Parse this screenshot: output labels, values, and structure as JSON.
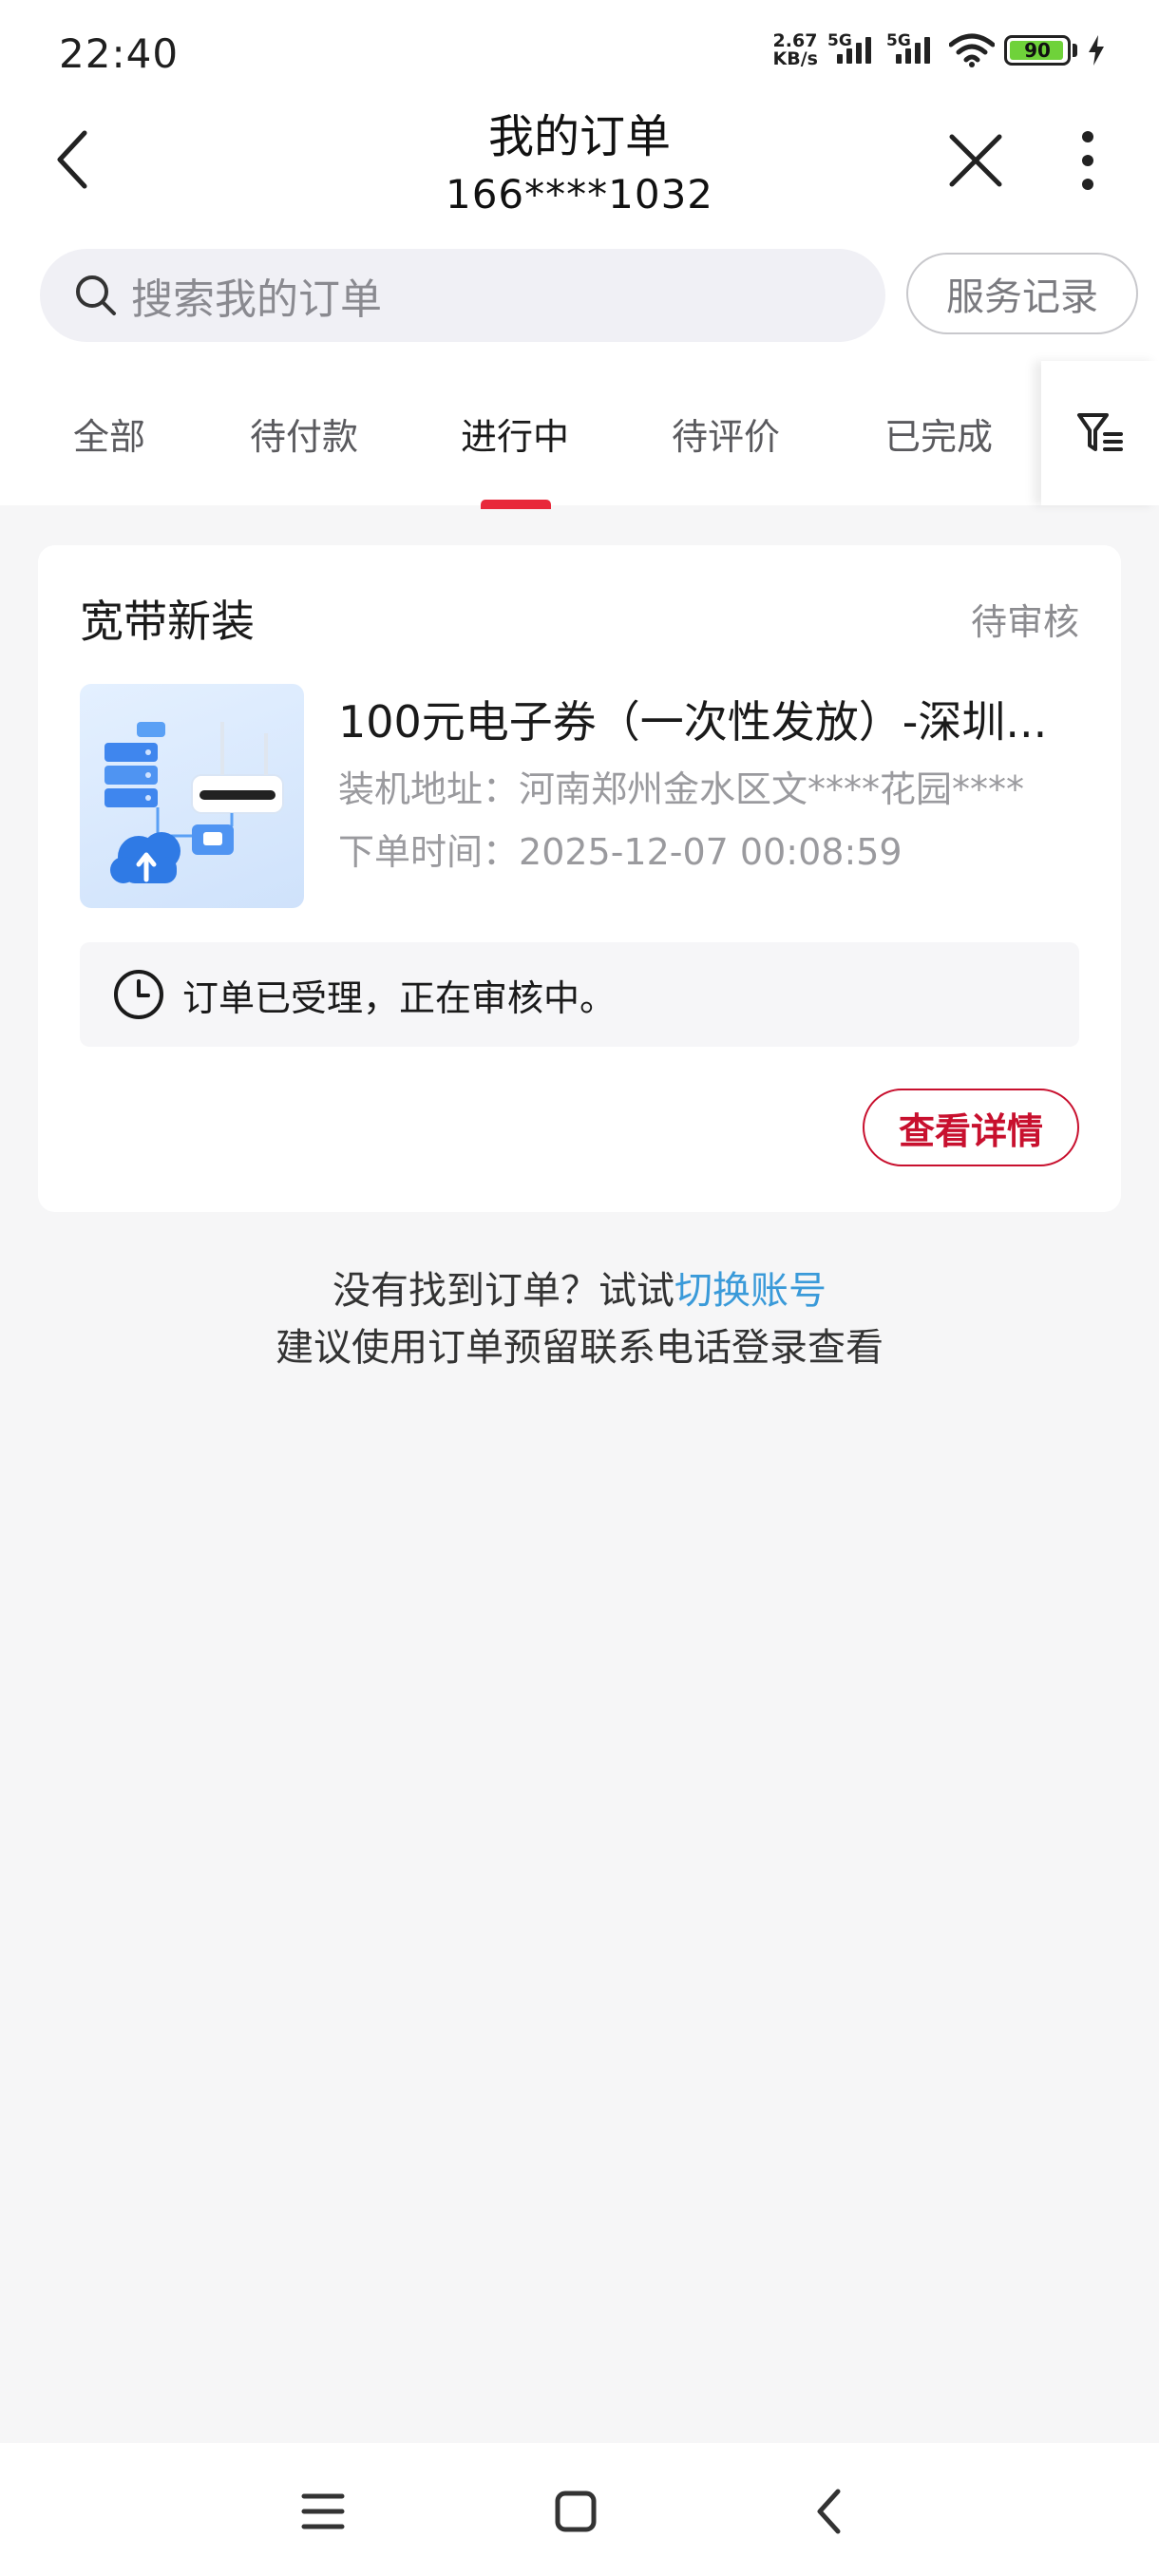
{
  "status_bar": {
    "time": "22:40",
    "net_speed_value": "2.67",
    "net_speed_unit": "KB/s",
    "sim1_type": "5G",
    "sim2_type": "5G",
    "battery_level": "90",
    "icons": [
      "signal-icon",
      "signal-icon",
      "wifi-icon",
      "battery-icon",
      "charging-icon"
    ]
  },
  "header": {
    "title": "我的订单",
    "subtitle": "166****1032",
    "icons": [
      "back-icon",
      "close-icon",
      "more-icon"
    ]
  },
  "search": {
    "placeholder": "搜索我的订单",
    "service_records_label": "服务记录"
  },
  "tabs": {
    "items": [
      {
        "label": "全部",
        "active": false
      },
      {
        "label": "待付款",
        "active": false
      },
      {
        "label": "进行中",
        "active": true
      },
      {
        "label": "待评价",
        "active": false
      },
      {
        "label": "已完成",
        "active": false
      }
    ],
    "filter_icon": "filter-icon"
  },
  "order": {
    "type": "宽带新装",
    "status": "待审核",
    "product_title": "100元电子券（一次性发放）-深圳...",
    "address_label": "装机地址：",
    "address_value": "河南郑州金水区文****花园****",
    "time_label": "下单时间：",
    "time_value": "2025-12-07 00:08:59",
    "notice": "订单已受理，正在审核中。",
    "detail_button": "查看详情"
  },
  "hint": {
    "line1_prefix": "没有找到订单？试试",
    "line1_link": "切换账号",
    "line2": "建议使用订单预留联系电话登录查看"
  },
  "colors": {
    "accent_red": "#c8102e",
    "tab_indicator": "#e8283a",
    "link_blue": "#3a9ad9",
    "background": "#f6f6f7"
  }
}
